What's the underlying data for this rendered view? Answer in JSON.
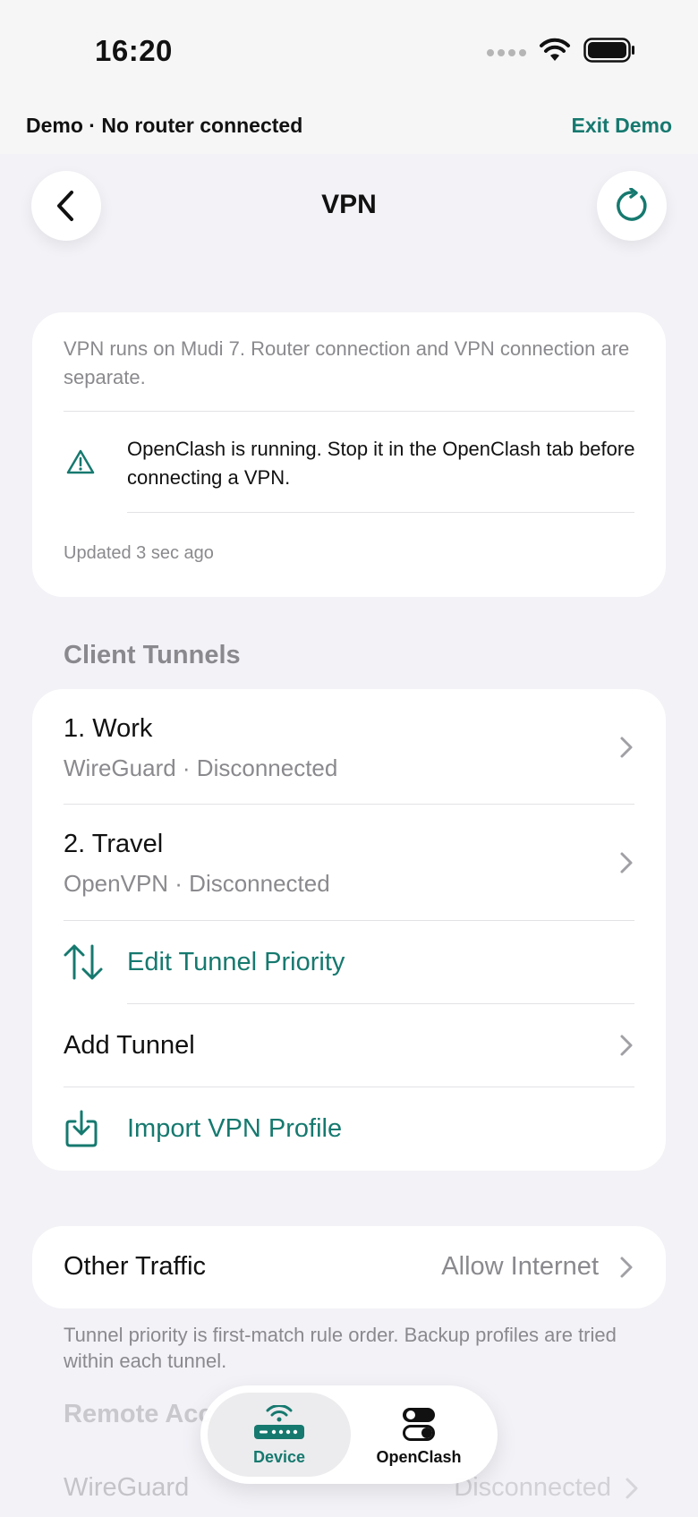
{
  "status_bar": {
    "time": "16:20"
  },
  "demo_banner": {
    "text": "Demo · No router connected",
    "exit_label": "Exit Demo"
  },
  "header": {
    "title": "VPN"
  },
  "info_card": {
    "description": "VPN runs on Mudi 7. Router connection and VPN connection are separate.",
    "warning": "OpenClash is running. Stop it in the OpenClash tab before connecting a VPN.",
    "updated": "Updated 3 sec ago"
  },
  "client_tunnels": {
    "header": "Client Tunnels",
    "items": [
      {
        "title": "1. Work",
        "subtitle": "WireGuard · Disconnected"
      },
      {
        "title": "2. Travel",
        "subtitle": "OpenVPN · Disconnected"
      }
    ],
    "edit_priority_label": "Edit Tunnel Priority",
    "add_tunnel_label": "Add Tunnel",
    "import_label": "Import VPN Profile"
  },
  "other_traffic": {
    "label": "Other Traffic",
    "value": "Allow Internet"
  },
  "footnote": "Tunnel priority is first-match rule order. Backup profiles are tried within each tunnel.",
  "remote_access": {
    "header": "Remote Acc",
    "wireguard_label": "WireGuard",
    "wireguard_status": "Disconnected"
  },
  "tabbar": {
    "device_label": "Device",
    "openclash_label": "OpenClash"
  },
  "colors": {
    "accent": "#16796f",
    "background": "#f2f2f7",
    "secondary_text": "#8a8a8e"
  }
}
